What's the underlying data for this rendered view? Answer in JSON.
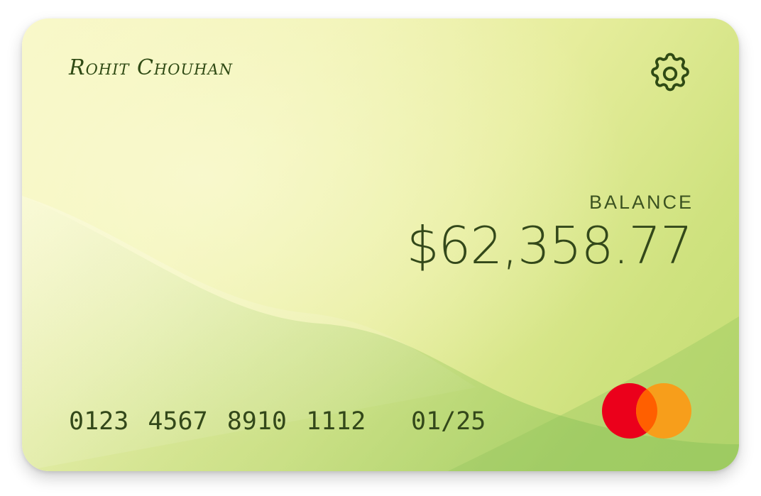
{
  "card": {
    "holder_name": "Rohit Chouhan",
    "balance_label": "BALANCE",
    "balance_amount": "$62,358.77",
    "card_number": "0123 4567 8910 1112",
    "expiry": "01/25"
  },
  "icons": {
    "settings": "gear-icon",
    "network": "mastercard-logo"
  },
  "colors": {
    "text_dark_green": "#33481a",
    "mastercard_red": "#eb001b",
    "mastercard_orange": "#f79e1b",
    "mastercard_overlap": "#ff5f00"
  }
}
